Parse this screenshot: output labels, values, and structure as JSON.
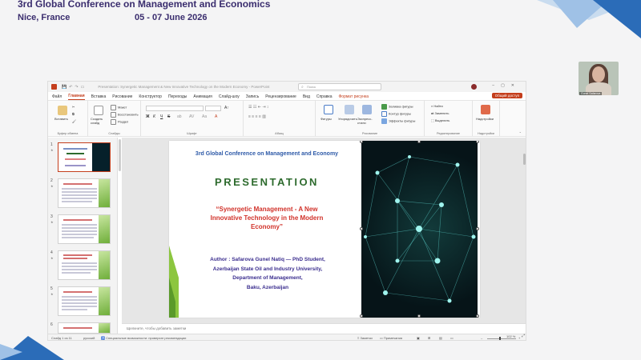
{
  "conference": {
    "title": "3rd Global Conference on Management and Economics",
    "location": "Nice, France",
    "date": "05 - 07 June 2026"
  },
  "webcam": {
    "name": "Gunel Safarova"
  },
  "window": {
    "doc_title": "Presentation: Synergetic Management & New Innovative Technology on the Modern Economy - PowerPoint",
    "search_placeholder": "Поиск"
  },
  "tabs": [
    "Файл",
    "Главная",
    "Вставка",
    "Рисование",
    "Конструктор",
    "Переходы",
    "Анимация",
    "Слайд-шоу",
    "Запись",
    "Рецензирование",
    "Вид",
    "Справка",
    "Формат рисунка"
  ],
  "share_label": "Общий доступ",
  "ribbon": {
    "clipboard": {
      "paste": "Вставить",
      "label": "Буфер обмена"
    },
    "slides": {
      "new_slide": "Создать слайд",
      "layout": "Макет",
      "reset": "Восстановить",
      "section": "Раздел",
      "label": "Слайды"
    },
    "font": {
      "bold": "Ж",
      "italic": "К",
      "underline": "Ч",
      "strike": "S",
      "label": "Шрифт"
    },
    "paragraph": {
      "label": "Абзац"
    },
    "drawing": {
      "shapes": "Фигуры",
      "arrange": "Упорядочить",
      "quick_styles": "Экспресс-стили",
      "fill": "Заливка фигуры",
      "outline": "Контур фигуры",
      "effects": "Эффекты фигуры",
      "label": "Рисование"
    },
    "editing": {
      "find": "Найти",
      "replace": "Заменить",
      "select": "Выделить",
      "label": "Редактирование"
    },
    "addins": {
      "addins": "Надстройки",
      "label": "Надстройки"
    }
  },
  "thumbnails": [
    {
      "num": "1",
      "selected": true
    },
    {
      "num": "2",
      "selected": false
    },
    {
      "num": "3",
      "selected": false
    },
    {
      "num": "4",
      "selected": false
    },
    {
      "num": "5",
      "selected": false
    },
    {
      "num": "6",
      "selected": false
    }
  ],
  "slide": {
    "conference": "3rd Global Conference on Management and Economy",
    "heading": "PRESENTATION",
    "topic_lines": [
      "“Synergetic Management - A New",
      "Innovative Technology in the Modern",
      "Economy”"
    ],
    "author_lines": [
      "Author :  Safarova Gunel Natiq — PhD Student,",
      "Azerbaijan State Oil and Industry University,",
      "Department of Management,",
      "Baku, Azerbaijan"
    ]
  },
  "notes_placeholder": "Щелкните, чтобы добавить заметки",
  "status": {
    "slide_of": "Слайд 1 из 11",
    "language": "русский",
    "accessibility": "Специальные возможности: проверьте рекомендации",
    "notes": "Заметки",
    "comments": "Примечания",
    "zoom": "102 %"
  },
  "colors": {
    "accent": "#c43e1c",
    "conference_text": "#3a2d6e",
    "slide_blue": "#2e5aa8",
    "slide_green": "#2e6b2e",
    "slide_red": "#d1322a",
    "slide_author": "#3a2d8e"
  }
}
